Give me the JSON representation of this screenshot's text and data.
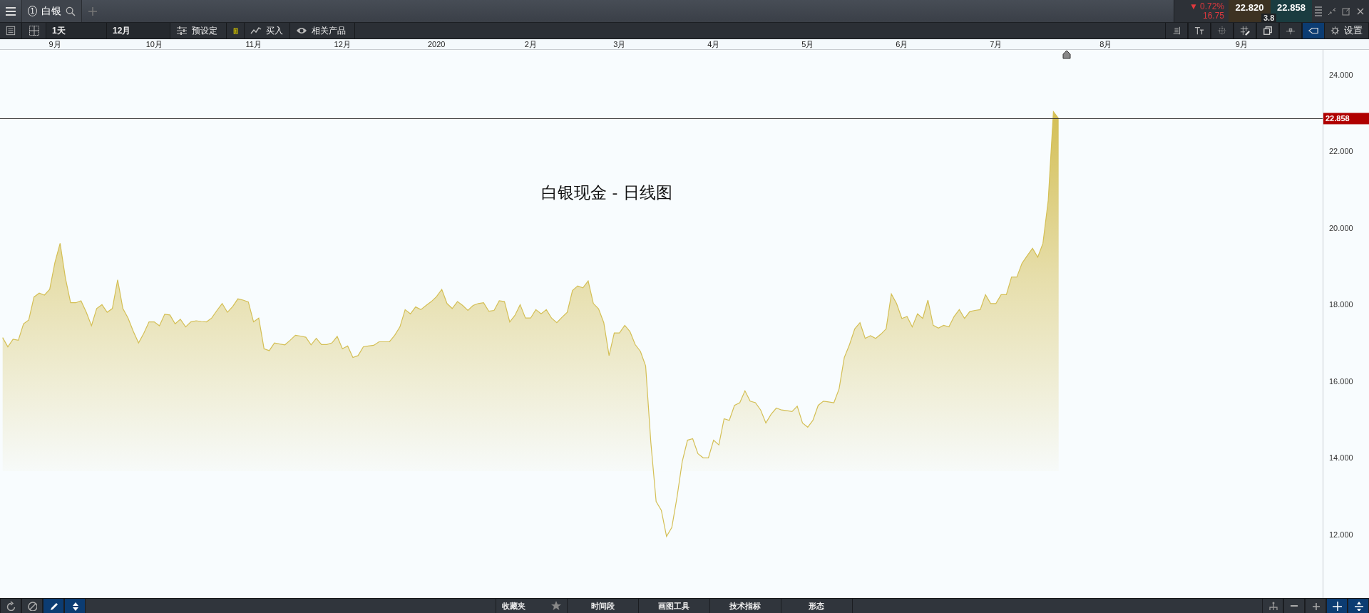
{
  "tab": {
    "number": "1",
    "label": "白银"
  },
  "quote": {
    "arrow": "▼",
    "change": "0.72%",
    "change_value": "16.75",
    "bid": "22.820",
    "ask": "22.858",
    "spread": "3.8"
  },
  "toolbar": {
    "views": [
      {
        "kind": "list"
      },
      {
        "kind": "grid"
      }
    ],
    "interval": "1天",
    "range": "12月",
    "buttons": [
      {
        "kind": "presets",
        "label": "预设定"
      },
      {
        "kind": "badge"
      },
      {
        "kind": "trend",
        "label": "买入"
      },
      {
        "kind": "eye",
        "label": "相关产品"
      }
    ],
    "tools": [
      {
        "kind": "align",
        "selected": false
      },
      {
        "kind": "text",
        "selected": false
      },
      {
        "kind": "dots",
        "selected": false
      },
      {
        "kind": "hashpen",
        "selected": false
      },
      {
        "kind": "windows",
        "selected": false
      },
      {
        "kind": "pin",
        "selected": false
      },
      {
        "kind": "tag",
        "selected": true
      }
    ],
    "settings": "设置"
  },
  "chart": {
    "chart_data": {
      "type": "area",
      "title": "白银现金 - 日线图",
      "categories": [
        null,
        null,
        null,
        null,
        null,
        null,
        null,
        null,
        null,
        null,
        "9月",
        null,
        null,
        null,
        null,
        null,
        null,
        null,
        null,
        null,
        null,
        null,
        null,
        null,
        null,
        null,
        null,
        null,
        null,
        "10月",
        null,
        null,
        null,
        null,
        null,
        null,
        null,
        null,
        null,
        null,
        null,
        null,
        null,
        null,
        null,
        null,
        null,
        null,
        "11月",
        null,
        null,
        null,
        null,
        null,
        null,
        null,
        null,
        null,
        null,
        null,
        null,
        null,
        null,
        null,
        null,
        "12月",
        null,
        null,
        null,
        null,
        null,
        null,
        null,
        null,
        null,
        null,
        null,
        null,
        null,
        null,
        null,
        null,
        null,
        "2020",
        null,
        null,
        null,
        null,
        null,
        null,
        null,
        null,
        null,
        null,
        null,
        null,
        null,
        null,
        null,
        null,
        null,
        "2月",
        null,
        null,
        null,
        null,
        null,
        null,
        null,
        null,
        null,
        null,
        null,
        null,
        null,
        null,
        null,
        null,
        "3月",
        null,
        null,
        null,
        null,
        null,
        null,
        null,
        null,
        null,
        null,
        null,
        null,
        null,
        null,
        null,
        null,
        null,
        "4月",
        null,
        null,
        null,
        null,
        null,
        null,
        null,
        null,
        null,
        null,
        null,
        null,
        null,
        null,
        null,
        null,
        null,
        "5月",
        null,
        null,
        null,
        null,
        null,
        null,
        null,
        null,
        null,
        null,
        null,
        null,
        null,
        null,
        null,
        null,
        null,
        "6月",
        null,
        null,
        null,
        null,
        null,
        null,
        null,
        null,
        null,
        null,
        null,
        null,
        null,
        null,
        null,
        null,
        null,
        "7月",
        null,
        null,
        null,
        null,
        null,
        null,
        null,
        null,
        null,
        null,
        null,
        null,
        null,
        null,
        null,
        null,
        null,
        null,
        null,
        null,
        "8月",
        null,
        null,
        null,
        null,
        null,
        null,
        null,
        null,
        null,
        null,
        null,
        null,
        null,
        null,
        null,
        null,
        null,
        null,
        null,
        null,
        null,
        null,
        null,
        null,
        null,
        "9月",
        null,
        null,
        null,
        null,
        null,
        null,
        null,
        null,
        null,
        null,
        null,
        null,
        null,
        null,
        null
      ],
      "series": [
        {
          "color": "#d4bf55",
          "values": [
            17.14,
            16.9,
            17.1,
            17.07,
            17.5,
            17.6,
            18.2,
            18.3,
            18.25,
            18.4,
            19.1,
            19.6,
            18.7,
            18.05,
            18.05,
            18.1,
            17.8,
            17.45,
            17.9,
            18.0,
            17.8,
            17.9,
            18.65,
            17.9,
            17.65,
            17.3,
            17.0,
            17.25,
            17.55,
            17.55,
            17.45,
            17.75,
            17.73,
            17.5,
            17.62,
            17.42,
            17.55,
            17.58,
            17.56,
            17.55,
            17.65,
            17.85,
            18.03,
            17.8,
            17.95,
            18.15,
            18.12,
            18.07,
            17.55,
            17.65,
            16.85,
            16.8,
            17.0,
            16.97,
            16.95,
            17.07,
            17.2,
            17.18,
            17.15,
            16.95,
            17.12,
            16.96,
            16.96,
            17.0,
            17.17,
            16.85,
            16.92,
            16.62,
            16.67,
            16.9,
            16.92,
            16.94,
            17.03,
            17.03,
            17.03,
            17.2,
            17.42,
            17.87,
            17.76,
            17.94,
            17.87,
            17.98,
            18.08,
            18.21,
            18.4,
            18.03,
            17.9,
            18.08,
            17.98,
            17.85,
            17.98,
            18.03,
            18.05,
            17.83,
            17.85,
            18.1,
            18.08,
            17.55,
            17.72,
            18.0,
            17.65,
            17.65,
            17.87,
            17.76,
            17.87,
            17.65,
            17.53,
            17.67,
            17.8,
            18.37,
            18.49,
            18.44,
            18.62,
            18.03,
            17.89,
            17.53,
            16.67,
            17.26,
            17.26,
            17.46,
            17.3,
            16.96,
            16.78,
            16.4,
            14.4,
            12.86,
            12.63,
            11.95,
            12.18,
            12.97,
            13.9,
            14.46,
            14.5,
            14.11,
            14.0,
            14.0,
            14.46,
            14.34,
            15.02,
            14.98,
            15.37,
            15.44,
            15.75,
            15.48,
            15.44,
            15.25,
            14.91,
            15.14,
            15.3,
            15.25,
            15.23,
            15.21,
            15.35,
            14.91,
            14.8,
            14.98,
            15.37,
            15.48,
            15.46,
            15.44,
            15.8,
            16.62,
            16.96,
            17.37,
            17.53,
            17.12,
            17.19,
            17.12,
            17.23,
            17.37,
            18.28,
            18.03,
            17.64,
            17.69,
            17.42,
            17.76,
            17.64,
            18.12,
            17.46,
            17.39,
            17.46,
            17.42,
            17.69,
            17.87,
            17.64,
            17.82,
            17.85,
            17.87,
            18.26,
            18.03,
            18.03,
            18.26,
            18.26,
            18.72,
            18.72,
            19.08,
            19.28,
            19.47,
            19.24,
            19.6,
            20.72,
            23.04,
            22.86,
            null,
            null,
            null,
            null,
            null,
            null,
            null,
            null,
            null,
            null,
            null,
            null,
            null,
            null,
            null,
            null,
            null,
            null,
            null,
            null,
            null,
            null,
            null,
            null,
            null,
            null,
            null,
            null,
            null,
            null,
            null,
            null,
            null,
            null,
            null,
            null,
            null,
            null,
            null,
            null,
            null,
            null,
            null,
            null,
            null,
            null,
            null,
            null,
            null,
            null
          ]
        }
      ],
      "ylim": [
        10.34,
        24.67
      ],
      "yticks": [
        {
          "value": 12,
          "label": "12.000"
        },
        {
          "value": 14,
          "label": "14.000"
        },
        {
          "value": 16,
          "label": "16.000"
        },
        {
          "value": 18,
          "label": "18.000"
        },
        {
          "value": 20,
          "label": "20.000"
        },
        {
          "value": 22,
          "label": "22.000"
        },
        {
          "value": 24,
          "label": "24.000"
        }
      ],
      "ref_lines": [
        {
          "axis": "y",
          "value": 22.858,
          "label": "22.858"
        }
      ]
    }
  },
  "bottom_bar": {
    "tools": [
      {
        "kind": "refresh",
        "selected": false
      },
      {
        "kind": "ban",
        "selected": false
      },
      {
        "kind": "pencil",
        "selected": true
      },
      {
        "kind": "updown",
        "selected": true
      }
    ],
    "tabs": [
      {
        "kind": "favorites",
        "label": "收藏夹"
      },
      {
        "kind": "plain",
        "label": "时间段"
      },
      {
        "kind": "plain",
        "label": "画图工具"
      },
      {
        "kind": "plain",
        "label": "技术指标"
      },
      {
        "kind": "plain",
        "label": "形态"
      }
    ],
    "right_tools": [
      {
        "kind": "tree",
        "selected": false
      },
      {
        "kind": "minus",
        "selected": false
      },
      {
        "kind": "plus",
        "selected": false
      },
      {
        "kind": "crosshair",
        "selected": true
      },
      {
        "kind": "expand",
        "selected": true
      }
    ]
  }
}
